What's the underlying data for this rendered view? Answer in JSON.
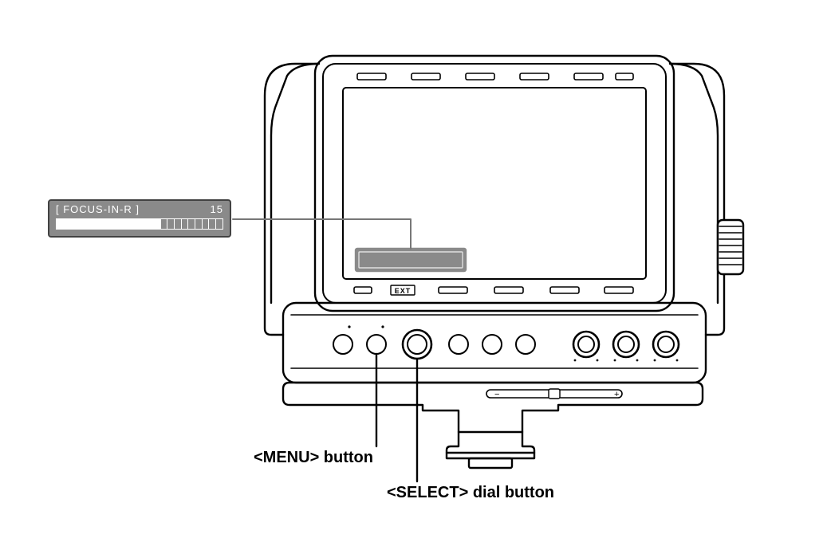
{
  "callout": {
    "title": "[ FOCUS-IN-R ]",
    "value": "15",
    "segments_total": 24,
    "segments_filled": 15
  },
  "screen_indicator": {
    "ext_label": "EXT"
  },
  "labels": {
    "menu_button": "<MENU> button",
    "select_dial": "<SELECT> dial button"
  },
  "slider": {
    "minus": "−",
    "plus": "+"
  }
}
